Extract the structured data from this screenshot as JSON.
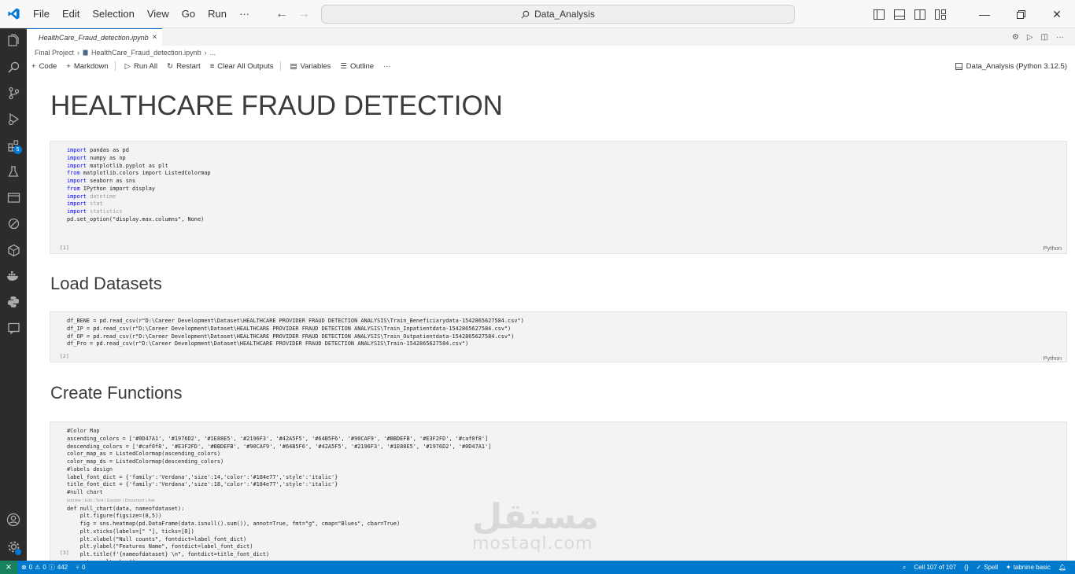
{
  "menu": {
    "file": "File",
    "edit": "Edit",
    "selection": "Selection",
    "view": "View",
    "go": "Go",
    "run": "Run",
    "more": "···"
  },
  "search": {
    "text": "Data_Analysis"
  },
  "tab": {
    "title": "HealthCare_Fraud_detection.ipynb",
    "close": "×"
  },
  "breadcrumb": {
    "folder": "Final Project",
    "file": "HealthCare_Fraud_detection.ipynb",
    "more": "..."
  },
  "toolbar": {
    "code": "Code",
    "markdown": "Markdown",
    "run_all": "Run All",
    "restart": "Restart",
    "clear": "Clear All Outputs",
    "variables": "Variables",
    "outline": "Outline",
    "more": "···"
  },
  "kernel": {
    "label": "Data_Analysis (Python 3.12.5)"
  },
  "notebook": {
    "title": "HEALTHCARE FRAUD DETECTION",
    "h_load": "Load Datasets",
    "h_func": "Create Functions",
    "cell1": {
      "exec": "[1]",
      "lang": "Python"
    },
    "cell2": {
      "exec": "[2]",
      "lang": "Python"
    },
    "cell3": {
      "exec": "[3]"
    },
    "code1": [
      "import pandas as pd",
      "import numpy as np",
      "import matplotlib.pyplot as plt",
      "from matplotlib.colors import ListedColormap",
      "import seaborn as sns",
      "from IPython import display",
      "import datetime",
      "import stat",
      "import statistics",
      "pd.set_option(\"display.max.columns\", None)"
    ],
    "code2": [
      "df_BENE = pd.read_csv(r\"D:\\Career Development\\Dataset\\HEALTHCARE PROVIDER FRAUD DETECTION ANALYSIS\\Train_Beneficiarydata-1542865627584.csv\")",
      "df_IP = pd.read_csv(r\"D:\\Career Development\\Dataset\\HEALTHCARE PROVIDER FRAUD DETECTION ANALYSIS\\Train_Inpatientdata-1542865627584.csv\")",
      "df_OP = pd.read_csv(r\"D:\\Career Development\\Dataset\\HEALTHCARE PROVIDER FRAUD DETECTION ANALYSIS\\Train_Outpatientdata-1542865627584.csv\")",
      "df_Pro = pd.read_csv(r\"D:\\Career Development\\Dataset\\HEALTHCARE PROVIDER FRAUD DETECTION ANALYSIS\\Train-1542865627584.csv\")"
    ],
    "code3": [
      "#Color Map",
      "ascending_colors = ['#0D47A1', '#1976D2', '#1E88E5', '#2196F3', '#42A5F5', '#64B5F6', '#90CAF9', '#BBDEFB', '#E3F2FD', '#caf0f8']",
      "descending_colors = ['#caf0f8', '#E3F2FD', '#BBDEFB', '#90CAF9', '#64B5F6', '#42A5F5', '#2196F3', '#1E88E5', '#1976D2', '#0D47A1']",
      "color_map_as = ListedColormap(ascending_colors)",
      "color_map_ds = ListedColormap(descending_colors)",
      "#labels design",
      "label_font_dict = {'family':'Verdana','size':14,'color':'#184e77','style':'italic'}",
      "title_font_dict = {'family':'Verdana','size':18,'color':'#184e77','style':'italic'}",
      "#null chart"
    ],
    "hint": "tabnine | Edit | Test | Explain | Document | Ask",
    "code3b": [
      "def null_chart(data, nameofdataset):",
      "    plt.figure(figsize=(8,5))",
      "    fig = sns.heatmap(pd.DataFrame(data.isnull().sum()), annot=True, fmt=\"g\", cmap=\"Blues\", cbar=True)",
      "    plt.xticks(labels=[\" \"], ticks=[0])",
      "    plt.xlabel(\"Null counts\", fontdict=label_font_dict)",
      "    plt.ylabel(\"Features Name\", fontdict=label_font_dict)",
      "    plt.title(f'{nameofdataset} \\n\", fontdict=title_font_dict)",
      "    return plt.show()"
    ]
  },
  "watermark": {
    "arabic": "مستقل",
    "latin": "mostaql.com"
  },
  "status": {
    "errors": "0",
    "warnings": "0",
    "info": "442",
    "ports": "0",
    "cell": "Cell 107 of 107",
    "spell": "Spell",
    "tabnine": "tabnine basic"
  },
  "colors": {
    "accent": "#007acc",
    "activity_bar": "#2c2c2c",
    "remote": "#16825d"
  }
}
